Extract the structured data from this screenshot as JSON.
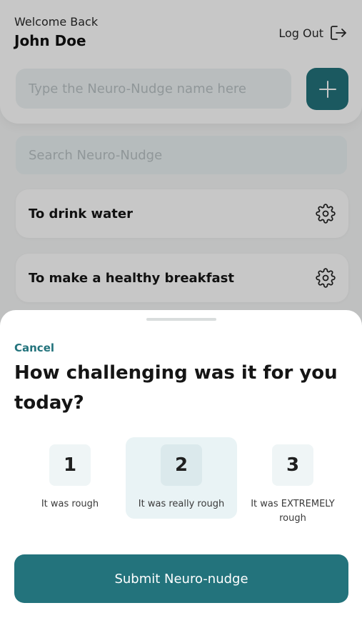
{
  "header": {
    "welcome": "Welcome Back",
    "username": "John Doe",
    "logout_label": "Log Out",
    "logout_icon": "logout-icon"
  },
  "new_nudge": {
    "placeholder": "Type the Neuro-Nudge name here",
    "value": "",
    "add_icon": "plus-icon"
  },
  "search": {
    "placeholder": "Search Neuro-Nudge",
    "value": ""
  },
  "nudges": [
    {
      "label": "To drink water",
      "icon": "gear-icon"
    },
    {
      "label": "To make a healthy breakfast",
      "icon": "gear-icon"
    }
  ],
  "sheet": {
    "cancel_label": "Cancel",
    "question": "How challenging was it for you today?",
    "options": [
      {
        "value": "1",
        "label": "It was rough"
      },
      {
        "value": "2",
        "label": "It was really rough"
      },
      {
        "value": "3",
        "label": "It was EXTREMELY rough"
      }
    ],
    "selected_option": "2",
    "submit_label": "Submit Neuro-nudge"
  },
  "colors": {
    "accent": "#23737c",
    "selected_bg": "#e9f3f5",
    "input_bg": "#eef3f4"
  }
}
